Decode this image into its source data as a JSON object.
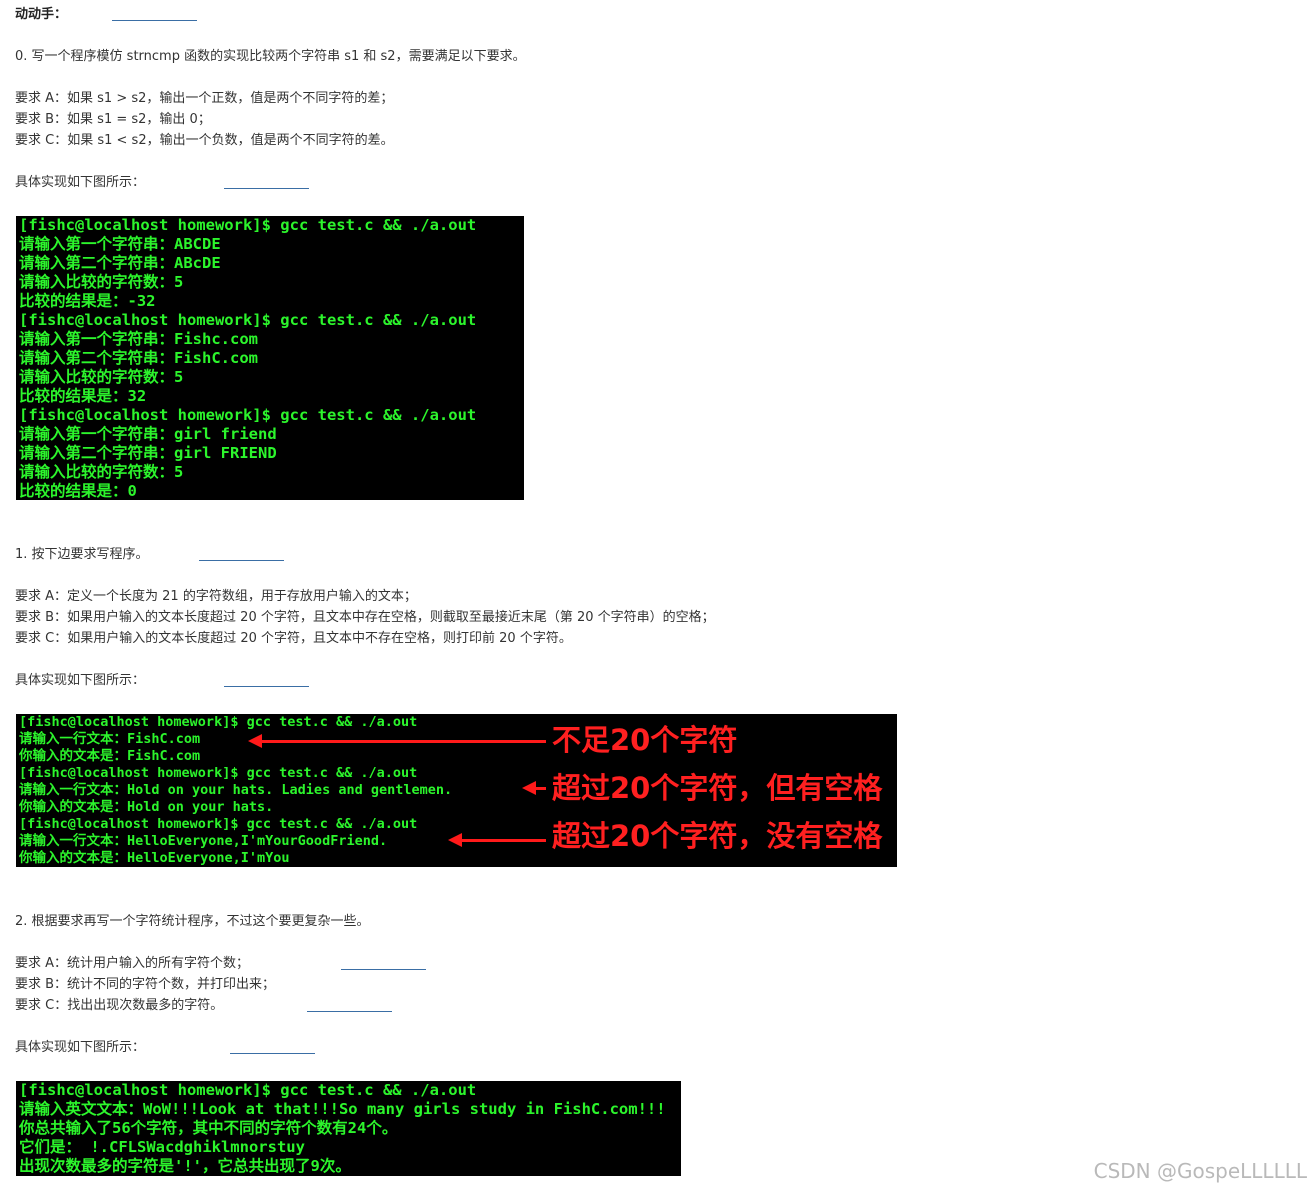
{
  "header": {
    "title": "动动手："
  },
  "q0": {
    "title": "0. 写一个程序模仿 strncmp 函数的实现比较两个字符串 s1 和 s2，需要满足以下要求。",
    "req_a": "要求 A：如果 s1 > s2，输出一个正数，值是两个不同字符的差；",
    "req_b": "要求 B：如果 s1 = s2，输出 0；",
    "req_c": "要求 C：如果 s1 < s2，输出一个负数，值是两个不同字符的差。",
    "impl": "具体实现如下图所示：",
    "terminal": [
      "[fishc@localhost homework]$ gcc test.c && ./a.out",
      "请输入第一个字符串：ABCDE",
      "请输入第二个字符串：ABcDE",
      "请输入比较的字符数：5",
      "比较的结果是：-32",
      "[fishc@localhost homework]$ gcc test.c && ./a.out",
      "请输入第一个字符串：Fishc.com",
      "请输入第二个字符串：FishC.com",
      "请输入比较的字符数：5",
      "比较的结果是：32",
      "[fishc@localhost homework]$ gcc test.c && ./a.out",
      "请输入第一个字符串：girl friend",
      "请输入第二个字符串：girl FRIEND",
      "请输入比较的字符数：5",
      "比较的结果是：0"
    ]
  },
  "q1": {
    "title": "1. 按下边要求写程序。",
    "req_a": "要求 A：定义一个长度为 21 的字符数组，用于存放用户输入的文本；",
    "req_b": "要求 B：如果用户输入的文本长度超过 20 个字符，且文本中存在空格，则截取至最接近末尾（第 20 个字符串）的空格；",
    "req_c": "要求 C：如果用户输入的文本长度超过 20 个字符，且文本中不存在空格，则打印前 20 个字符。",
    "impl": "具体实现如下图所示：",
    "terminal": [
      "[fishc@localhost homework]$ gcc test.c && ./a.out",
      "请输入一行文本：FishC.com",
      "你输入的文本是：FishC.com",
      "[fishc@localhost homework]$ gcc test.c && ./a.out",
      "请输入一行文本：Hold on your hats. Ladies and gentlemen.",
      "你输入的文本是：Hold on your hats.",
      "[fishc@localhost homework]$ gcc test.c && ./a.out",
      "请输入一行文本：HelloEveryone,I'mYourGoodFriend.",
      "你输入的文本是：HelloEveryone,I'mYou"
    ],
    "annotations": [
      "不足20个字符",
      "超过20个字符，但有空格",
      "超过20个字符，没有空格"
    ],
    "annotation_color": "#ff2020"
  },
  "q2": {
    "title": "2. 根据要求再写一个字符统计程序，不过这个要更复杂一些。",
    "req_a": "要求 A：统计用户输入的所有字符个数；",
    "req_b": "要求 B：统计不同的字符个数，并打印出来；",
    "req_c": "要求 C：找出出现次数最多的字符。",
    "impl": "具体实现如下图所示：",
    "terminal": [
      "[fishc@localhost homework]$ gcc test.c && ./a.out",
      "请输入英文文本：WoW!!!Look at that!!!So many girls study in FishC.com!!!",
      "你总共输入了56个字符，其中不同的字符个数有24个。",
      "它们是： !.CFLSWacdghiklmnorstuy",
      "出现次数最多的字符是'!'，它总共出现了9次。"
    ]
  },
  "watermark": "CSDN @GospeLLLLLL",
  "colors": {
    "terminal_bg": "#000000",
    "terminal_text": "#2cf52c",
    "link_underline": "#3a6ea5"
  }
}
